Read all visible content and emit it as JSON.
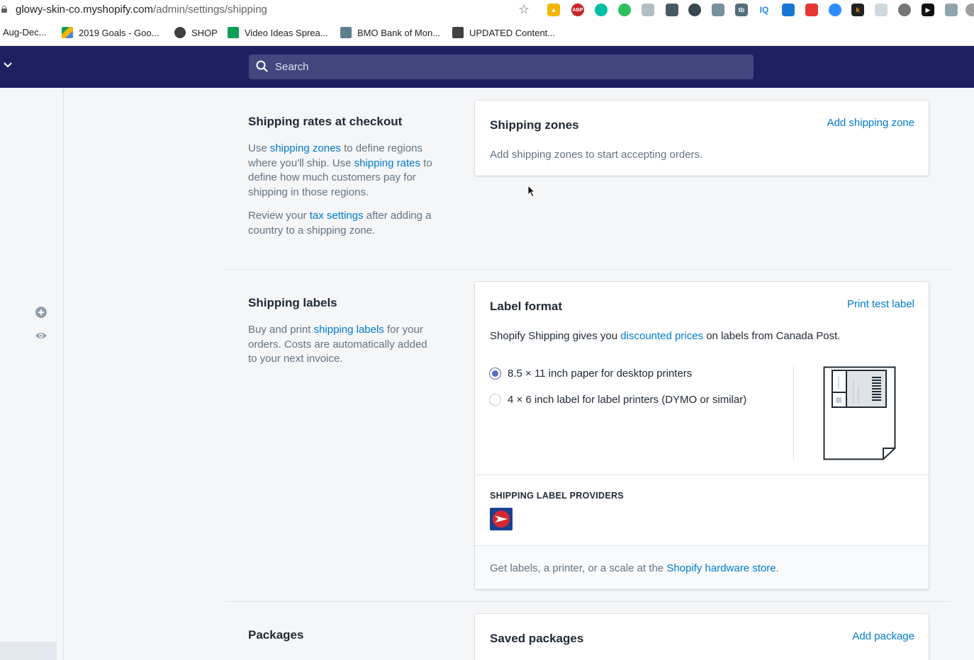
{
  "browser": {
    "url_host": "glowy-skin-co.myshopify.com",
    "url_path": "/admin/settings/shipping",
    "bookmarks": [
      {
        "label": "Aug-Dec..."
      },
      {
        "label": "2019 Goals - Goo..."
      },
      {
        "label": "SHOP"
      },
      {
        "label": "Video Ideas Sprea..."
      },
      {
        "label": "BMO Bank of Mon..."
      },
      {
        "label": "UPDATED Content..."
      }
    ]
  },
  "topbar": {
    "search_placeholder": "Search",
    "bg_color": "#1c2260"
  },
  "shipping_rates": {
    "title": "Shipping rates at checkout",
    "desc1_a": "Use ",
    "desc1_link1": "shipping zones",
    "desc1_b": " to define regions where you'll ship. Use ",
    "desc1_link2": "shipping rates",
    "desc1_c": " to define how much customers pay for shipping in those regions.",
    "desc2_a": "Review your ",
    "desc2_link": "tax settings",
    "desc2_b": " after adding a country to a shipping zone.",
    "card": {
      "title": "Shipping zones",
      "action": "Add shipping zone",
      "text": "Add shipping zones to start accepting orders."
    }
  },
  "shipping_labels": {
    "title": "Shipping labels",
    "desc_a": "Buy and print ",
    "desc_link": "shipping labels",
    "desc_b": " for your orders. Costs are automatically added to your next invoice.",
    "card": {
      "title": "Label format",
      "action": "Print test label",
      "intro_a": "Shopify Shipping gives you ",
      "intro_link": "discounted prices",
      "intro_b": " on labels from Canada Post.",
      "options": [
        {
          "label": "8.5 × 11 inch paper for desktop printers",
          "selected": true
        },
        {
          "label": "4 × 6 inch label for label printers (DYMO or similar)",
          "selected": false
        }
      ],
      "providers_heading": "SHIPPING LABEL PROVIDERS",
      "provider_icon": "canada-post-icon",
      "footer_a": "Get labels, a printer, or a scale at the ",
      "footer_link": "Shopify hardware store",
      "footer_b": "."
    }
  },
  "packages": {
    "title": "Packages",
    "card": {
      "title": "Saved packages",
      "action": "Add package"
    }
  },
  "colors": {
    "link": "#007ace",
    "accent": "#5c6ac4"
  }
}
